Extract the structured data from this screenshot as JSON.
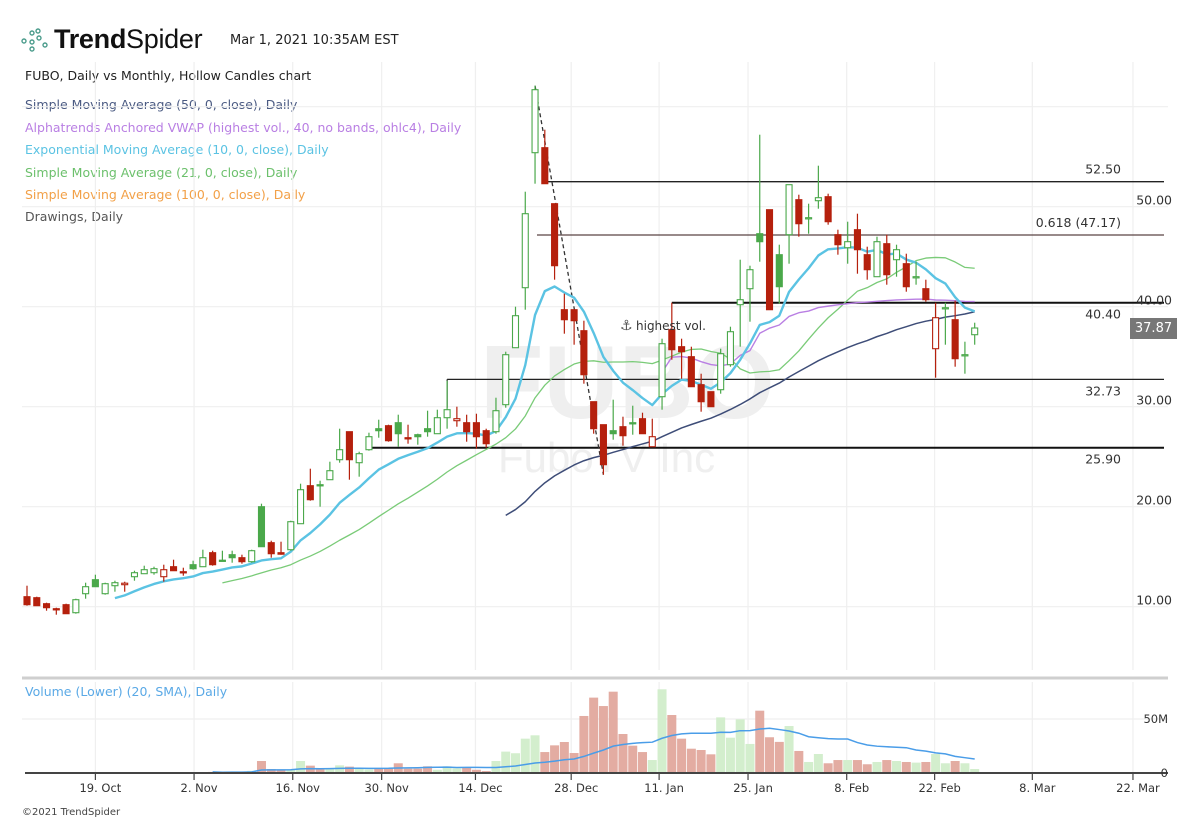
{
  "header": {
    "brand_bold": "Trend",
    "brand_light": "Spider",
    "timestamp": "Mar 1, 2021 10:35AM EST",
    "chart_title": "FUBO, Daily vs Monthly, Hollow Candles chart"
  },
  "legend": [
    {
      "text": "Simple Moving Average (50, 0, close), Daily",
      "color": "#4a5a82"
    },
    {
      "text": "Alphatrends Anchored VWAP (highest vol., 40, no bands, ohlc4), Daily",
      "color": "#b97fe3"
    },
    {
      "text": "Exponential Moving Average (10, 0, close), Daily",
      "color": "#5bc3e3"
    },
    {
      "text": "Simple Moving Average (21, 0, close), Daily",
      "color": "#6cc06c"
    },
    {
      "text": "Simple Moving Average (100, 0, close), Daily",
      "color": "#f2a047"
    },
    {
      "text": "Drawings, Daily",
      "color": "#555555"
    }
  ],
  "volume_legend": "Volume (Lower) (20, SMA), Daily",
  "watermark": {
    "symbol": "FUBO",
    "name": "FuboTV Inc"
  },
  "last_price": "37.87",
  "anchor_label": "highest vol.",
  "copyright": "©2021 TrendSpider",
  "colors": {
    "up": "#4aa84a",
    "down": "#b5200d",
    "vol_up": "#d3eecd",
    "vol_down": "#e3aca2",
    "ema10": "#5bc3e3",
    "sma21": "#7acb78",
    "sma50": "#3e4d78",
    "vwap": "#b97fe3",
    "vol_sma": "#4a9de8"
  },
  "chart_data": {
    "type": "candlestick",
    "title": "FUBO, Daily vs Monthly, Hollow Candles chart",
    "ylim": [
      0,
      70
    ],
    "y_ticks": [
      {
        "v": 10,
        "label": "10.00"
      },
      {
        "v": 20,
        "label": "20.00"
      },
      {
        "v": 30,
        "label": "30.00"
      },
      {
        "v": 40,
        "label": "40.00"
      },
      {
        "v": 50,
        "label": "50.00"
      }
    ],
    "y_grid": [
      10,
      20,
      30,
      40,
      50,
      60
    ],
    "x_ticks": [
      {
        "i": 7,
        "label": "19. Oct"
      },
      {
        "i": 17.1,
        "label": "2. Nov"
      },
      {
        "i": 27.2,
        "label": "16. Nov"
      },
      {
        "i": 36.3,
        "label": "30. Nov"
      },
      {
        "i": 45.9,
        "label": "14. Dec"
      },
      {
        "i": 55.7,
        "label": "28. Dec"
      },
      {
        "i": 64.7,
        "label": "11. Jan"
      },
      {
        "i": 73.8,
        "label": "25. Jan"
      },
      {
        "i": 83.9,
        "label": "8. Feb"
      },
      {
        "i": 92.9,
        "label": "22. Feb"
      },
      {
        "i": 102.9,
        "label": "8. Mar"
      },
      {
        "i": 113.2,
        "label": "22. Mar"
      }
    ],
    "candles_ohlc": [
      [
        11.0,
        12.1,
        10.1,
        10.2
      ],
      [
        10.9,
        11.0,
        10.1,
        10.1
      ],
      [
        10.3,
        10.4,
        9.6,
        9.9
      ],
      [
        9.8,
        9.9,
        9.2,
        9.7
      ],
      [
        10.2,
        10.3,
        9.3,
        9.3
      ],
      [
        9.4,
        10.8,
        9.3,
        10.7
      ],
      [
        11.3,
        12.4,
        10.8,
        12.0
      ],
      [
        12.7,
        13.2,
        12.0,
        12.0
      ],
      [
        11.3,
        12.4,
        11.2,
        12.3
      ],
      [
        12.1,
        12.6,
        11.5,
        12.4
      ],
      [
        12.2,
        12.5,
        11.5,
        12.35
      ],
      [
        13.0,
        13.6,
        12.6,
        13.4
      ],
      [
        13.3,
        14.1,
        13.3,
        13.7
      ],
      [
        13.4,
        14.0,
        13.2,
        13.8
      ],
      [
        13.0,
        14.2,
        12.5,
        13.7
      ],
      [
        14.0,
        14.7,
        13.6,
        13.6
      ],
      [
        13.5,
        13.9,
        13.1,
        13.4
      ],
      [
        14.2,
        14.6,
        13.7,
        13.8
      ],
      [
        14.0,
        15.7,
        14.0,
        14.9
      ],
      [
        15.4,
        15.6,
        14.1,
        14.2
      ],
      [
        14.65,
        15.6,
        14.6,
        14.6
      ],
      [
        15.2,
        15.6,
        14.4,
        14.9
      ],
      [
        14.9,
        15.2,
        14.3,
        14.5
      ],
      [
        14.5,
        15.7,
        14.4,
        15.6
      ],
      [
        20.0,
        20.3,
        16.0,
        16.0
      ],
      [
        16.4,
        16.6,
        14.9,
        15.3
      ],
      [
        15.4,
        16.5,
        15.2,
        15.25
      ],
      [
        15.7,
        18.6,
        15.6,
        18.5
      ],
      [
        18.3,
        22.3,
        18.3,
        21.7
      ],
      [
        22.1,
        23.8,
        20.6,
        20.7
      ],
      [
        22.2,
        22.6,
        20.0,
        22.1
      ],
      [
        22.7,
        24.5,
        22.7,
        23.6
      ],
      [
        24.7,
        27.8,
        24.4,
        25.7
      ],
      [
        27.5,
        27.5,
        22.7,
        24.7
      ],
      [
        24.4,
        25.5,
        23.0,
        25.3
      ],
      [
        25.7,
        27.4,
        25.6,
        27.0
      ],
      [
        27.8,
        28.7,
        26.9,
        27.6
      ],
      [
        28.1,
        28.2,
        26.5,
        26.6
      ],
      [
        28.4,
        29.2,
        26.0,
        27.3
      ],
      [
        26.9,
        28.2,
        26.3,
        26.8
      ],
      [
        27.2,
        27.3,
        26.2,
        27.0
      ],
      [
        27.8,
        29.6,
        27.0,
        27.5
      ],
      [
        27.3,
        29.7,
        27.3,
        28.9
      ],
      [
        28.9,
        32.6,
        27.8,
        29.7
      ],
      [
        28.6,
        30.0,
        28.0,
        28.8
      ],
      [
        28.4,
        29.2,
        26.5,
        27.5
      ],
      [
        28.4,
        29.3,
        25.8,
        27.0
      ],
      [
        27.6,
        27.8,
        25.9,
        26.3
      ],
      [
        27.5,
        30.9,
        27.3,
        29.6
      ],
      [
        30.2,
        35.5,
        29.9,
        35.2
      ],
      [
        35.9,
        40.0,
        35.9,
        39.1
      ],
      [
        41.9,
        51.5,
        39.7,
        49.3
      ],
      [
        55.4,
        62.1,
        52.3,
        61.7
      ],
      [
        55.9,
        57.7,
        52.3,
        52.3
      ],
      [
        50.3,
        50.3,
        42.7,
        44.1
      ],
      [
        39.7,
        41.3,
        37.3,
        38.7
      ],
      [
        39.7,
        39.7,
        36.2,
        38.6
      ],
      [
        37.6,
        38.6,
        32.3,
        33.2
      ],
      [
        30.5,
        30.5,
        27.3,
        27.8
      ],
      [
        28.2,
        28.2,
        23.2,
        24.2
      ],
      [
        27.6,
        30.7,
        26.7,
        27.3
      ],
      [
        28.0,
        29.0,
        26.1,
        27.1
      ],
      [
        28.4,
        30.1,
        27.2,
        28.3
      ],
      [
        28.8,
        29.4,
        27.3,
        27.3
      ],
      [
        26.0,
        28.8,
        26.0,
        27.0
      ],
      [
        31.0,
        36.8,
        29.7,
        36.3
      ],
      [
        37.7,
        40.4,
        34.7,
        35.7
      ],
      [
        36.0,
        36.8,
        32.8,
        35.5
      ],
      [
        35.0,
        36.0,
        32.0,
        32.0
      ],
      [
        32.2,
        33.3,
        29.5,
        30.5
      ],
      [
        31.5,
        31.5,
        30.0,
        30.0
      ],
      [
        31.7,
        35.8,
        31.3,
        35.3
      ],
      [
        34.2,
        38.0,
        34.0,
        37.5
      ],
      [
        40.2,
        44.7,
        36.0,
        40.7
      ],
      [
        41.8,
        44.1,
        38.5,
        43.7
      ],
      [
        47.3,
        57.2,
        44.5,
        46.5
      ],
      [
        49.7,
        49.7,
        39.7,
        39.7
      ],
      [
        45.2,
        46.2,
        40.3,
        42.0
      ],
      [
        47.2,
        52.2,
        44.3,
        52.2
      ],
      [
        50.7,
        51.2,
        47.0,
        48.3
      ],
      [
        48.8,
        50.3,
        47.3,
        48.9
      ],
      [
        50.6,
        54.1,
        49.8,
        50.9
      ],
      [
        51.0,
        51.3,
        48.2,
        48.5
      ],
      [
        47.2,
        47.7,
        45.2,
        46.2
      ],
      [
        45.9,
        48.5,
        44.3,
        46.5
      ],
      [
        47.7,
        49.3,
        43.3,
        45.7
      ],
      [
        45.2,
        46.0,
        42.7,
        43.7
      ],
      [
        43.0,
        47.0,
        43.0,
        46.5
      ],
      [
        46.3,
        47.2,
        42.2,
        43.2
      ],
      [
        44.7,
        46.2,
        43.0,
        45.7
      ],
      [
        44.3,
        45.3,
        41.5,
        42.0
      ],
      [
        42.9,
        44.5,
        42.2,
        43.0
      ],
      [
        41.8,
        42.7,
        40.5,
        40.7
      ],
      [
        35.8,
        40.4,
        32.9,
        38.9
      ],
      [
        39.8,
        40.4,
        36.2,
        39.9
      ],
      [
        38.7,
        40.6,
        34.0,
        34.8
      ],
      [
        35.1,
        36.5,
        33.3,
        35.2
      ],
      [
        37.2,
        38.4,
        36.2,
        37.87
      ]
    ],
    "volume_millions": [
      null,
      null,
      null,
      null,
      null,
      null,
      null,
      null,
      null,
      null,
      null,
      null,
      null,
      null,
      null,
      null,
      null,
      null,
      null,
      1.0,
      0.5,
      1.0,
      0.8,
      2.0,
      11.1,
      3.7,
      3.3,
      3.3,
      11.1,
      6.8,
      3.3,
      4.6,
      7.1,
      5.9,
      4.6,
      3.3,
      4.6,
      4.6,
      9.0,
      4.0,
      4.0,
      6.2,
      3.0,
      6.2,
      4.3,
      4.9,
      3.0,
      1.8,
      11.1,
      19.8,
      18.3,
      31.8,
      34.9,
      19.4,
      25.6,
      28.7,
      18.5,
      52.8,
      69.8,
      62.0,
      75.3,
      36.1,
      25.3,
      19.4,
      12.0,
      77.5,
      53.7,
      31.8,
      22.5,
      21.3,
      17.3,
      51.5,
      32.7,
      49.7,
      26.9,
      57.7,
      33.1,
      28.8,
      43.5,
      20.4,
      10.2,
      17.6,
      9.0,
      12.0,
      12.0,
      12.0,
      8.1,
      10.2,
      12.0,
      11.1,
      10.2,
      9.6,
      10.2,
      17.6,
      9.0,
      11.1,
      9.0,
      3.7
    ],
    "volume_ticks": [
      {
        "v": 0,
        "label": "0"
      },
      {
        "v": 50,
        "label": "50M"
      }
    ],
    "indicators": {
      "ema_period": 10,
      "sma_short": 21,
      "sma_long": 50,
      "vwap_anchor_index": 65,
      "volume_sma": 20
    },
    "levels": [
      {
        "price": 52.5,
        "label": "52.50",
        "from_i": 53,
        "label_pos": "above",
        "color": "#222222"
      },
      {
        "price": 47.17,
        "label": "0.618 (47.17)",
        "from_i": 52.2,
        "label_pos": "above",
        "color": "#5a4444"
      },
      {
        "price": 40.4,
        "label": "40.40",
        "from_i": 66,
        "label_pos": "below",
        "color": "#111111"
      },
      {
        "price": 32.73,
        "label": "32.73",
        "from_i": 43,
        "label_pos": "below",
        "color": "#222222"
      },
      {
        "price": 25.9,
        "label": "25.90",
        "from_i": 35,
        "label_pos": "below",
        "color": "#111111"
      }
    ],
    "trendline": {
      "from": [
        52,
        62.1
      ],
      "to": [
        59,
        23.2
      ]
    }
  }
}
